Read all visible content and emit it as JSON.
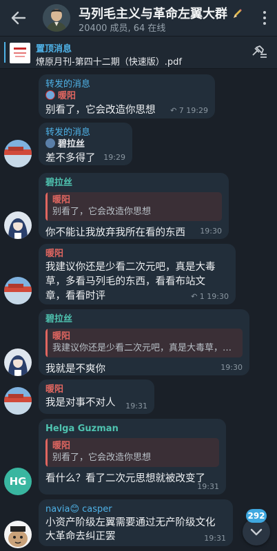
{
  "header": {
    "title": "马列毛主义与革命左翼大群",
    "subtitle": "20400 成员, 64 在线"
  },
  "pinned": {
    "label": "置顶消息",
    "text": "燎原月刊-第四十二期（快速版）.pdf"
  },
  "messages": [
    {
      "forwarded_label": "转发的消息",
      "forward_from": "暖阳",
      "text": "别看了，它会改造你思想",
      "forwards": "7",
      "time": "19:29"
    },
    {
      "forwarded_label": "转发的消息",
      "forward_from": "碧拉丝",
      "text": "差不多得了",
      "time": "19:29"
    },
    {
      "sender": "碧拉丝",
      "reply_name": "暖阳",
      "reply_text": "别看了，它会改造你思想",
      "text": "你不能让我放弃我所在看的东西",
      "time": "19:30"
    },
    {
      "sender": "暖阳",
      "text_lines": [
        "我建议你还是少看二次元吧，真是大毒",
        "草，多看马列毛的东西，看看布站文",
        "章，看看时评"
      ],
      "forwards": "1",
      "time": "19:30"
    },
    {
      "sender": "碧拉丝",
      "reply_name": "暖阳",
      "reply_text": "我建议你还是少看二次元吧，真是大毒草，…",
      "text": "我就是不爽你",
      "time": "19:30"
    },
    {
      "sender": "暖阳",
      "text": "我是对事不对人",
      "time": "19:31"
    },
    {
      "sender": "Helga Guzman",
      "avatar_initials": "HG",
      "reply_name": "暖阳",
      "reply_text": "别看了，它会改造你思想",
      "text": "看什么？看了二次元思想就被改变了",
      "time": "19:31"
    },
    {
      "sender": "navia😊 casper",
      "text_lines": [
        "小资产阶级左翼需要通过无产阶级文化",
        "大革命去纠正罢"
      ],
      "time": "19:31"
    }
  ],
  "unread_count": "292",
  "colors": {
    "accent": "#4fb3e8",
    "red_name": "#e06660",
    "teal_name": "#4fc3b0",
    "bubble": "#222e3a",
    "background": "#1a2028"
  }
}
